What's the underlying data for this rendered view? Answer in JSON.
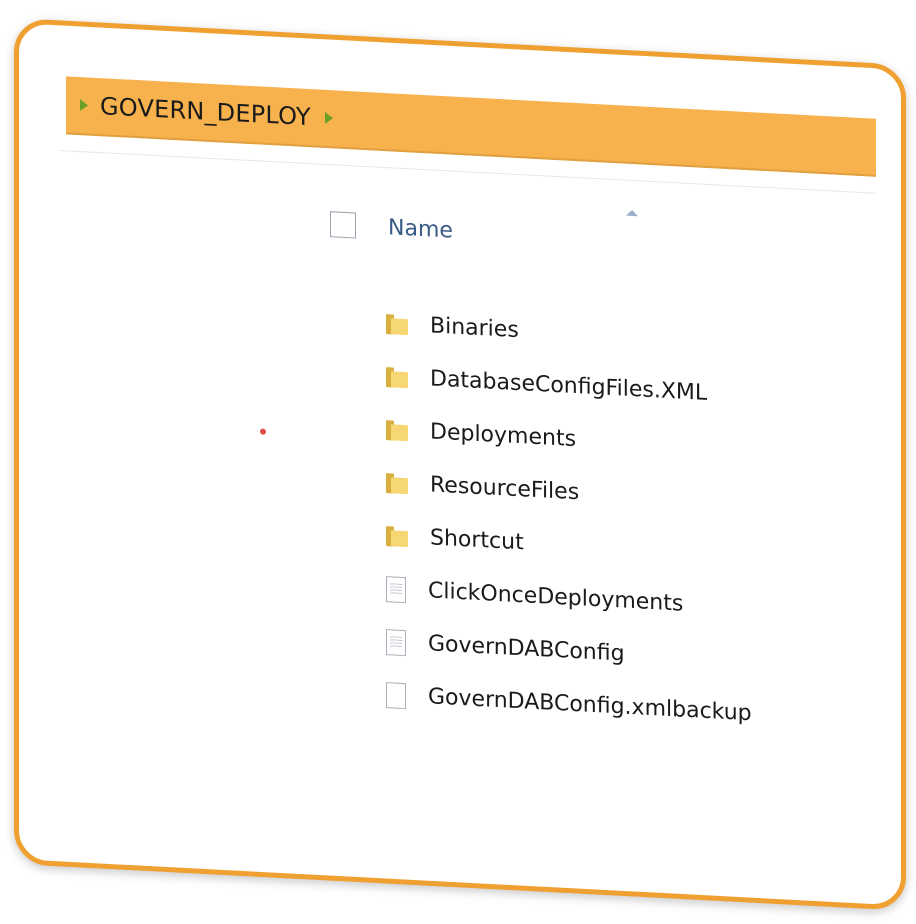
{
  "breadcrumb": {
    "folder": "GOVERN_DEPLOY"
  },
  "columns": {
    "name": "Name"
  },
  "items": [
    {
      "label": "Binaries",
      "icon": "folder-icon"
    },
    {
      "label": "DatabaseConfigFiles.XML",
      "icon": "folder-icon"
    },
    {
      "label": "Deployments",
      "icon": "folder-icon"
    },
    {
      "label": "ResourceFiles",
      "icon": "folder-icon"
    },
    {
      "label": "Shortcut",
      "icon": "folder-icon"
    },
    {
      "label": "ClickOnceDeployments",
      "icon": "file-icon"
    },
    {
      "label": "GovernDABConfig",
      "icon": "file-icon"
    },
    {
      "label": "GovernDABConfig.xmlbackup",
      "icon": "file-icon"
    }
  ],
  "colors": {
    "highlight": "#f7b24e",
    "frame": "#f0a030",
    "header_text": "#3a5a86"
  }
}
